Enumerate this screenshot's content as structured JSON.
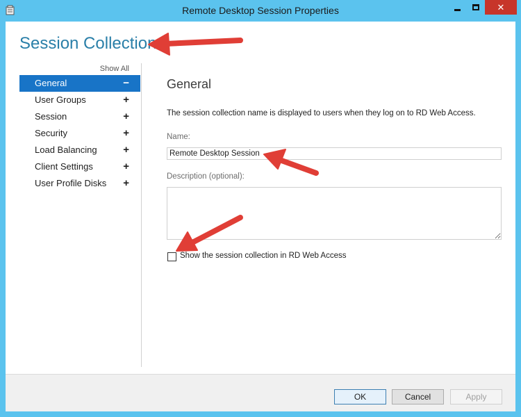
{
  "window": {
    "title": "Remote Desktop Session Properties",
    "icon": "rd-session-properties-icon",
    "controls": {
      "minimize": "minimize-icon",
      "maximize": "maximize-icon",
      "close": "close-icon",
      "close_glyph": "✕"
    }
  },
  "header": {
    "title": "Session Collection"
  },
  "sidebar": {
    "show_all_label": "Show All",
    "items": [
      {
        "label": "General",
        "sign": "−",
        "active": true
      },
      {
        "label": "User Groups",
        "sign": "+"
      },
      {
        "label": "Session",
        "sign": "+"
      },
      {
        "label": "Security",
        "sign": "+"
      },
      {
        "label": "Load Balancing",
        "sign": "+"
      },
      {
        "label": "Client Settings",
        "sign": "+"
      },
      {
        "label": "User Profile Disks",
        "sign": "+"
      }
    ]
  },
  "general": {
    "section_title": "General",
    "description": "The session collection name is displayed to users when they log on to RD Web Access.",
    "name_label": "Name:",
    "name_value": "Remote Desktop Session",
    "description_label": "Description (optional):",
    "description_value": "",
    "show_in_web_access_label": "Show the session collection in RD Web Access",
    "show_in_web_access_checked": false
  },
  "footer": {
    "ok_label": "OK",
    "cancel_label": "Cancel",
    "apply_label": "Apply",
    "apply_enabled": false
  },
  "colors": {
    "title_bar": "#5bc3ee",
    "close_button": "#c7352a",
    "accent": "#2a7fa8",
    "selection": "#1874c7",
    "annotation_arrow": "#e03e36"
  }
}
